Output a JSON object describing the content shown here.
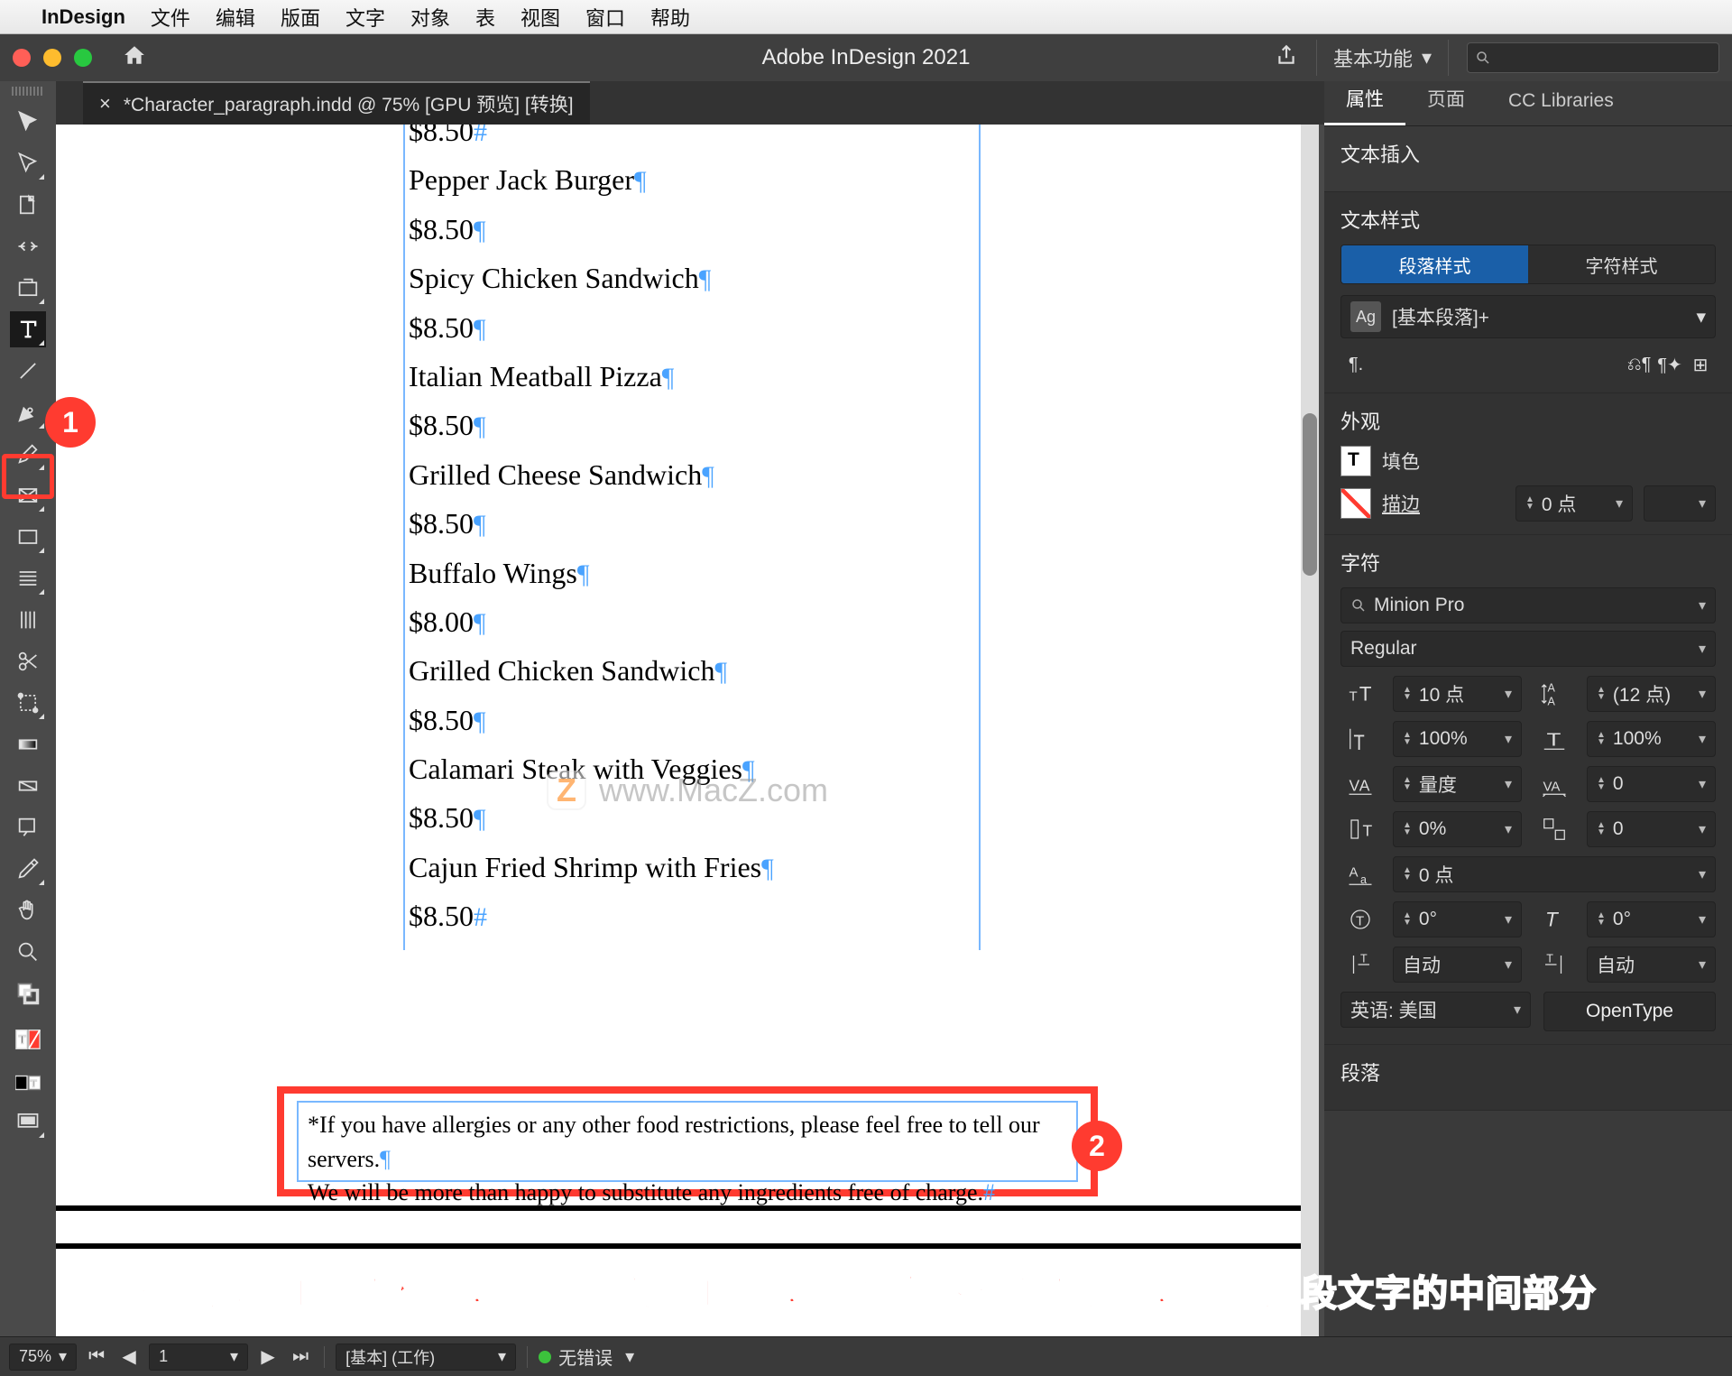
{
  "menubar": {
    "app": "InDesign",
    "items": [
      "文件",
      "编辑",
      "版面",
      "文字",
      "对象",
      "表",
      "视图",
      "窗口",
      "帮助"
    ]
  },
  "window": {
    "title": "Adobe InDesign 2021",
    "workspace": "基本功能"
  },
  "document": {
    "tab_label": "*Character_paragraph.indd @ 75% [GPU 预览] [转换]",
    "menu_items": [
      {
        "name": "Pepper Jack Burger",
        "price": "$8.50"
      },
      {
        "name": "Spicy Chicken Sandwich",
        "price": "$8.50"
      },
      {
        "name": "Italian Meatball Pizza",
        "price": "$8.50"
      },
      {
        "name": "Grilled Cheese Sandwich",
        "price": "$8.50"
      },
      {
        "name": "Buffalo Wings",
        "price": "$8.00"
      },
      {
        "name": "Grilled Chicken Sandwich",
        "price": "$8.50"
      },
      {
        "name": "Calamari Steak with Veggies",
        "price": "$8.50"
      },
      {
        "name": "Cajun Fried Shrimp with Fries",
        "price": "$8.50"
      }
    ],
    "top_price": "$8.50",
    "footer_line1": "*If you have allergies or any other food restrictions, please feel free to tell our servers.",
    "footer_line2": "We will be more than happy to substitute any ingredients free of charge.",
    "watermark": "www.MacZ.com"
  },
  "panels": {
    "tabs": {
      "properties": "属性",
      "pages": "页面",
      "cc": "CC Libraries"
    },
    "text_insert": "文本插入",
    "text_styles_heading": "文本样式",
    "para_styles": "段落样式",
    "char_styles": "字符样式",
    "default_para_style": "[基本段落]+",
    "appearance_heading": "外观",
    "fill_label": "填色",
    "stroke_label": "描边",
    "stroke_value": "0 点",
    "character_heading": "字符",
    "font_family": "Minion Pro",
    "font_style": "Regular",
    "font_size": "10 点",
    "leading": "(12 点)",
    "hscale": "100%",
    "vscale": "100%",
    "kerning": "量度",
    "tracking": "0",
    "baseline_shift": "0%",
    "skew_val": "0",
    "baseline_pt": "0 点",
    "rotate": "0°",
    "italic_deg": "0°",
    "auto1": "自动",
    "auto2": "自动",
    "language": "英语: 美国",
    "opentype": "OpenType",
    "paragraph_heading": "段落"
  },
  "statusbar": {
    "zoom": "75%",
    "page": "1",
    "preset": "[基本] (工作)",
    "errors": "无错误"
  },
  "annotations": {
    "badge1": "1",
    "badge2": "2",
    "instruction": "在左边的工具面板中，选择「文字工具」，然后向下到页面底部，点击这段文字的中间部分"
  }
}
